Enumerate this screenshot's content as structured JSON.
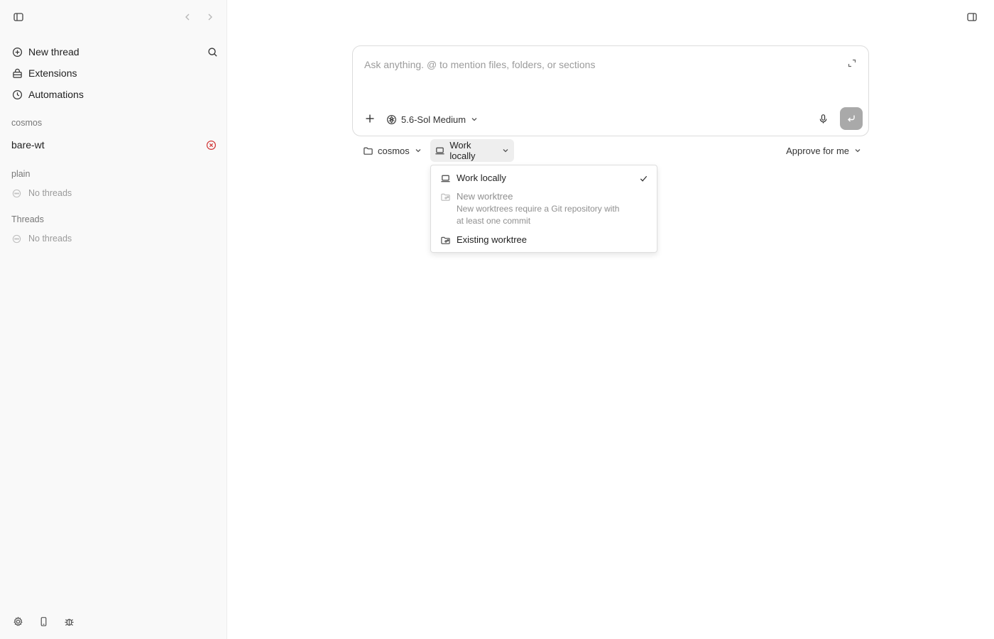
{
  "sidebar": {
    "menu": [
      {
        "label": "New thread",
        "icon": "plus-circle-icon"
      },
      {
        "label": "Extensions",
        "icon": "extensions-icon"
      },
      {
        "label": "Automations",
        "icon": "clock-icon"
      }
    ],
    "sections": {
      "cosmos": {
        "label": "cosmos",
        "project": "bare-wt"
      },
      "plain": {
        "label": "plain",
        "empty": "No threads"
      },
      "threads": {
        "label": "Threads",
        "empty": "No threads"
      }
    }
  },
  "composer": {
    "placeholder": "Ask anything. @ to mention files, folders, or sections",
    "value": "",
    "model": "5.6-Sol Medium"
  },
  "toolbar": {
    "project": "cosmos",
    "environment": "Work locally",
    "approval": "Approve for me"
  },
  "dropdown": {
    "items": [
      {
        "label": "Work locally",
        "selected": true,
        "disabled": false
      },
      {
        "label": "New worktree",
        "description": "New worktrees require a Git repository with at least one commit",
        "selected": false,
        "disabled": true
      },
      {
        "label": "Existing worktree",
        "selected": false,
        "disabled": false
      }
    ]
  },
  "colors": {
    "sidebar_bg": "#f9f9f9",
    "error": "#d03535",
    "send_disabled": "#a9a9a9"
  }
}
